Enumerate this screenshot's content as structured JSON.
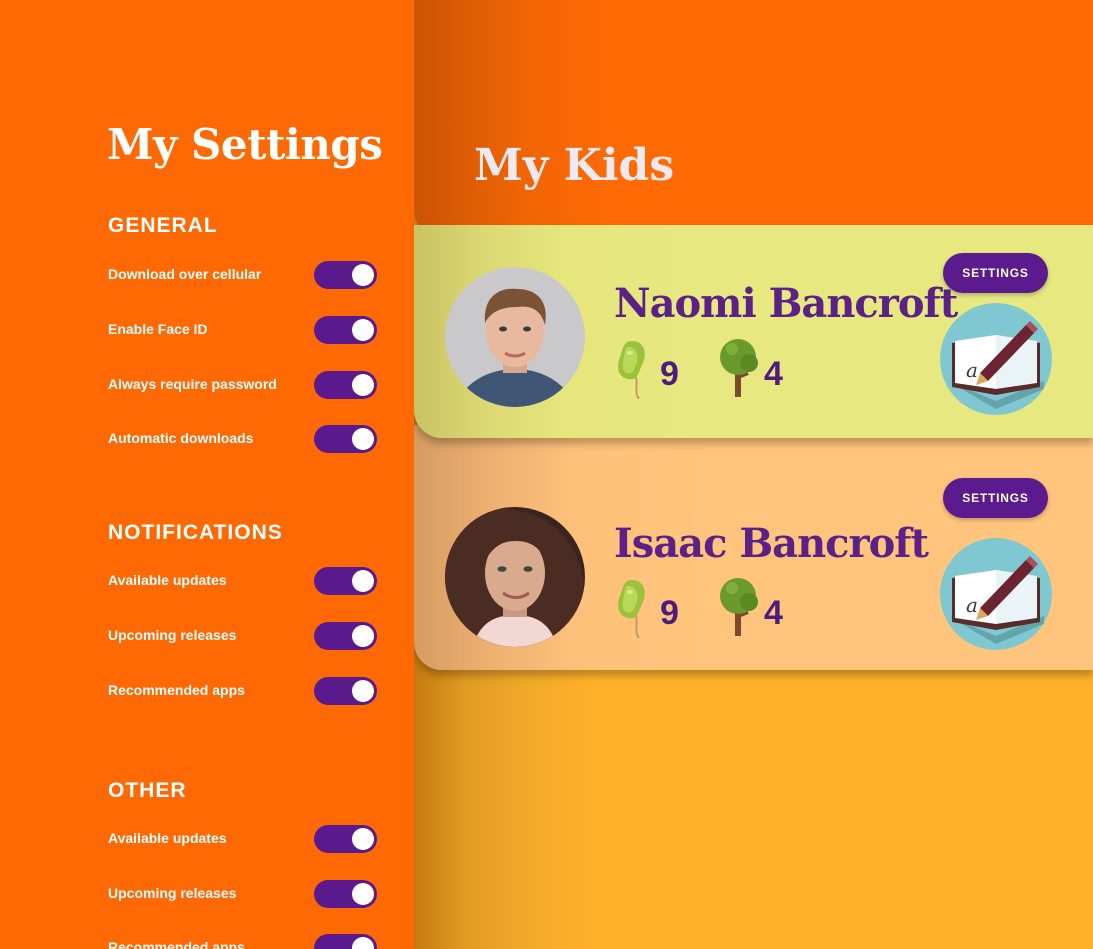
{
  "colors": {
    "sidebar": "#ff6904",
    "accent": "#5a1a8e",
    "kids_title": "#f1e9f0",
    "card1": "#e7e880",
    "card2": "#ffc57d",
    "main_bg": "#ffad2a"
  },
  "settings": {
    "title": "My Settings",
    "sections": [
      {
        "heading": "GENERAL",
        "items": [
          {
            "label": "Download over cellular",
            "on": true
          },
          {
            "label": "Enable Face ID",
            "on": true
          },
          {
            "label": "Always require password",
            "on": true
          },
          {
            "label": "Automatic downloads",
            "on": true
          }
        ]
      },
      {
        "heading": "NOTIFICATIONS",
        "items": [
          {
            "label": "Available updates",
            "on": true
          },
          {
            "label": "Upcoming releases",
            "on": true
          },
          {
            "label": "Recommended apps",
            "on": true
          }
        ]
      },
      {
        "heading": "OTHER",
        "items": [
          {
            "label": "Available updates",
            "on": true
          },
          {
            "label": "Upcoming releases",
            "on": true
          },
          {
            "label": "Recommended apps",
            "on": true
          }
        ]
      }
    ]
  },
  "kids": {
    "title": "My Kids",
    "list": [
      {
        "name": "Naomi Bancroft",
        "seeds": "9",
        "trees": "4",
        "settings_label": "SETTINGS",
        "app_icon": "book-pen-icon"
      },
      {
        "name": "Isaac Bancroft",
        "seeds": "9",
        "trees": "4",
        "settings_label": "SETTINGS",
        "app_icon": "book-pen-icon"
      }
    ]
  }
}
